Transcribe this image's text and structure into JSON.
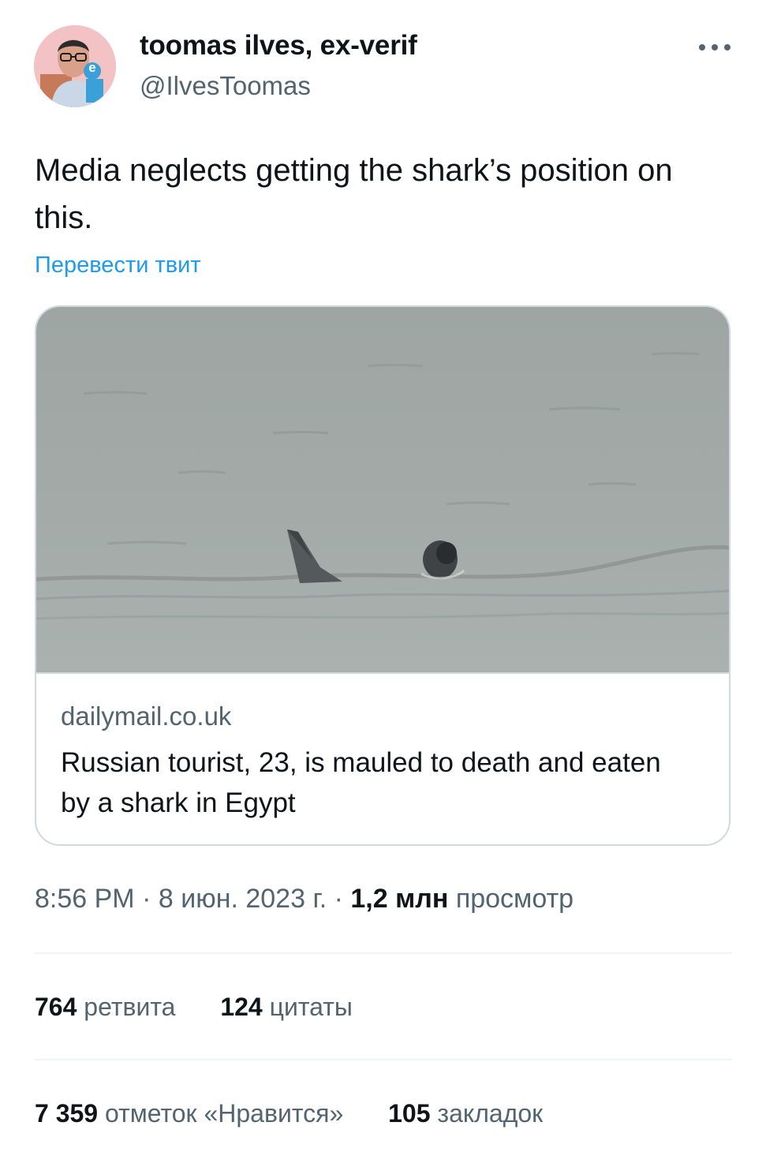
{
  "author": {
    "display_name": "toomas ilves, ex-verif",
    "handle": "@IlvesToomas",
    "avatar_badge": "e"
  },
  "tweet": {
    "text": "Media neglects getting the shark’s position on this.",
    "translate_label": "Перевести твит"
  },
  "link_card": {
    "domain": "dailymail.co.uk",
    "title": "Russian tourist, 23, is mauled to death and eaten by a shark in Egypt"
  },
  "meta": {
    "time": "8:56 PM",
    "separator": " · ",
    "date": "8 июн. 2023 г.",
    "views_count": "1,2 млн",
    "views_label": "просмотр"
  },
  "stats": {
    "retweets_count": "764",
    "retweets_label": "ретвита",
    "quotes_count": "124",
    "quotes_label": "цитаты",
    "likes_count": "7 359",
    "likes_label": "отметок «Нравится»",
    "bookmarks_count": "105",
    "bookmarks_label": "закладок"
  },
  "colors": {
    "link": "#1d9bf0",
    "secondary_text": "#536471",
    "primary_text": "#0f1419",
    "border": "#cfd9de"
  }
}
